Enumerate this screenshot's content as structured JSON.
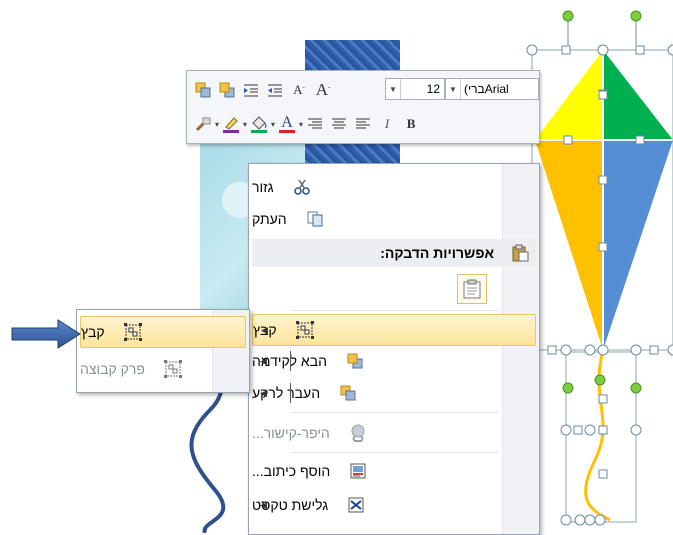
{
  "mini_toolbar": {
    "font_name": "(בריArial",
    "font_size": "12",
    "buttons_row1": [
      "bring-forward",
      "send-backward",
      "increase-indent",
      "decrease-indent",
      "shrink-font",
      "grow-font"
    ],
    "buttons_row2": [
      "format-painter",
      "line-color",
      "fill-color",
      "font-color",
      "align-right",
      "center",
      "align-left",
      "italic",
      "bold"
    ],
    "italic_glyph": "I",
    "bold_glyph": "B",
    "shrink_glyph": "A",
    "grow_glyph": "A",
    "font_color_glyph": "A"
  },
  "context_menu": {
    "items": [
      {
        "label": "גזור",
        "icon": "scissors-icon",
        "enabled": true
      },
      {
        "label": "העתק",
        "icon": "copy-icon",
        "enabled": true
      },
      {
        "label": "אפשרויות הדבקה:",
        "icon": "paste-icon",
        "enabled": true
      },
      {
        "label": "קבץ",
        "icon": "group-icon",
        "enabled": true,
        "submenu": true,
        "highlighted": true
      },
      {
        "label": "הבא לקידמה",
        "icon": "bring-front-icon",
        "enabled": true,
        "submenu": true
      },
      {
        "label": "העבר לרקע",
        "icon": "send-back-icon",
        "enabled": true,
        "submenu": true
      },
      {
        "label": "היפר-קישור...",
        "icon": "hyperlink-icon",
        "enabled": false
      },
      {
        "label": "הוסף כיתוב...",
        "icon": "insert-caption-icon",
        "enabled": true
      },
      {
        "label": "גלישת טקסט",
        "icon": "text-wrap-icon",
        "enabled": true,
        "submenu": true
      }
    ]
  },
  "submenu": {
    "items": [
      {
        "label": "קבץ",
        "icon": "group-icon",
        "enabled": true,
        "highlighted": true
      },
      {
        "label": "פרק קבוצה",
        "icon": "ungroup-icon",
        "enabled": false
      }
    ]
  },
  "colors": {
    "kite_yellow": "#ffff00",
    "kite_green": "#00b050",
    "kite_orange": "#ffc000",
    "kite_blue": "#558ed5",
    "pointer_arrow": "#2f5597",
    "highlight": "#fde49a"
  }
}
